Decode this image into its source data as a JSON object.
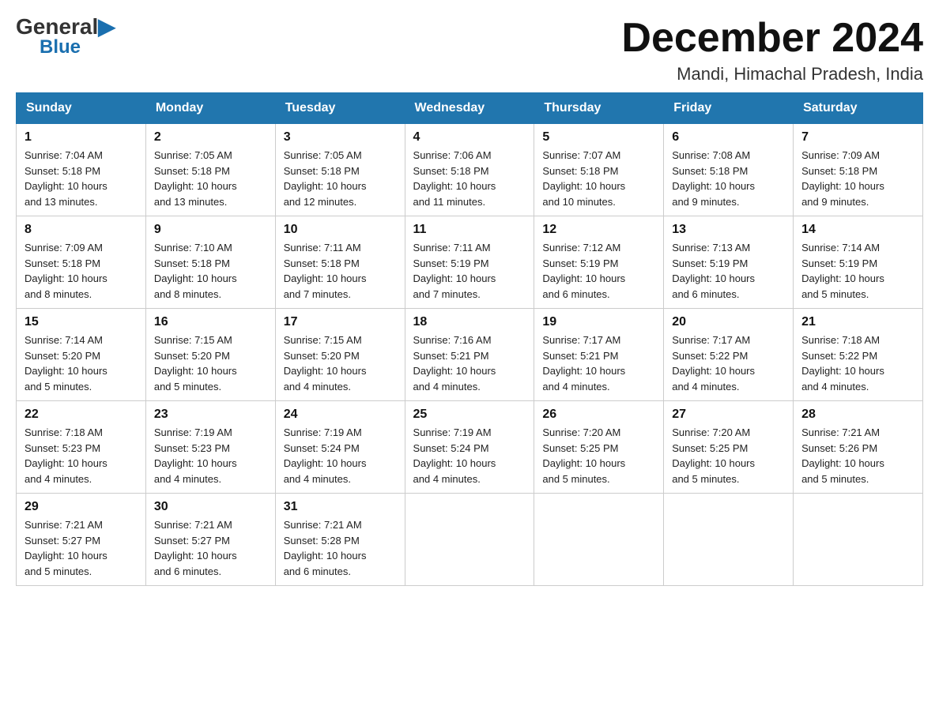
{
  "logo": {
    "general": "General",
    "blue": "Blue",
    "triangle": "▶"
  },
  "header": {
    "title": "December 2024",
    "subtitle": "Mandi, Himachal Pradesh, India"
  },
  "weekdays": [
    "Sunday",
    "Monday",
    "Tuesday",
    "Wednesday",
    "Thursday",
    "Friday",
    "Saturday"
  ],
  "weeks": [
    [
      {
        "day": "1",
        "sunrise": "7:04 AM",
        "sunset": "5:18 PM",
        "daylight": "10 hours and 13 minutes."
      },
      {
        "day": "2",
        "sunrise": "7:05 AM",
        "sunset": "5:18 PM",
        "daylight": "10 hours and 13 minutes."
      },
      {
        "day": "3",
        "sunrise": "7:05 AM",
        "sunset": "5:18 PM",
        "daylight": "10 hours and 12 minutes."
      },
      {
        "day": "4",
        "sunrise": "7:06 AM",
        "sunset": "5:18 PM",
        "daylight": "10 hours and 11 minutes."
      },
      {
        "day": "5",
        "sunrise": "7:07 AM",
        "sunset": "5:18 PM",
        "daylight": "10 hours and 10 minutes."
      },
      {
        "day": "6",
        "sunrise": "7:08 AM",
        "sunset": "5:18 PM",
        "daylight": "10 hours and 9 minutes."
      },
      {
        "day": "7",
        "sunrise": "7:09 AM",
        "sunset": "5:18 PM",
        "daylight": "10 hours and 9 minutes."
      }
    ],
    [
      {
        "day": "8",
        "sunrise": "7:09 AM",
        "sunset": "5:18 PM",
        "daylight": "10 hours and 8 minutes."
      },
      {
        "day": "9",
        "sunrise": "7:10 AM",
        "sunset": "5:18 PM",
        "daylight": "10 hours and 8 minutes."
      },
      {
        "day": "10",
        "sunrise": "7:11 AM",
        "sunset": "5:18 PM",
        "daylight": "10 hours and 7 minutes."
      },
      {
        "day": "11",
        "sunrise": "7:11 AM",
        "sunset": "5:19 PM",
        "daylight": "10 hours and 7 minutes."
      },
      {
        "day": "12",
        "sunrise": "7:12 AM",
        "sunset": "5:19 PM",
        "daylight": "10 hours and 6 minutes."
      },
      {
        "day": "13",
        "sunrise": "7:13 AM",
        "sunset": "5:19 PM",
        "daylight": "10 hours and 6 minutes."
      },
      {
        "day": "14",
        "sunrise": "7:14 AM",
        "sunset": "5:19 PM",
        "daylight": "10 hours and 5 minutes."
      }
    ],
    [
      {
        "day": "15",
        "sunrise": "7:14 AM",
        "sunset": "5:20 PM",
        "daylight": "10 hours and 5 minutes."
      },
      {
        "day": "16",
        "sunrise": "7:15 AM",
        "sunset": "5:20 PM",
        "daylight": "10 hours and 5 minutes."
      },
      {
        "day": "17",
        "sunrise": "7:15 AM",
        "sunset": "5:20 PM",
        "daylight": "10 hours and 4 minutes."
      },
      {
        "day": "18",
        "sunrise": "7:16 AM",
        "sunset": "5:21 PM",
        "daylight": "10 hours and 4 minutes."
      },
      {
        "day": "19",
        "sunrise": "7:17 AM",
        "sunset": "5:21 PM",
        "daylight": "10 hours and 4 minutes."
      },
      {
        "day": "20",
        "sunrise": "7:17 AM",
        "sunset": "5:22 PM",
        "daylight": "10 hours and 4 minutes."
      },
      {
        "day": "21",
        "sunrise": "7:18 AM",
        "sunset": "5:22 PM",
        "daylight": "10 hours and 4 minutes."
      }
    ],
    [
      {
        "day": "22",
        "sunrise": "7:18 AM",
        "sunset": "5:23 PM",
        "daylight": "10 hours and 4 minutes."
      },
      {
        "day": "23",
        "sunrise": "7:19 AM",
        "sunset": "5:23 PM",
        "daylight": "10 hours and 4 minutes."
      },
      {
        "day": "24",
        "sunrise": "7:19 AM",
        "sunset": "5:24 PM",
        "daylight": "10 hours and 4 minutes."
      },
      {
        "day": "25",
        "sunrise": "7:19 AM",
        "sunset": "5:24 PM",
        "daylight": "10 hours and 4 minutes."
      },
      {
        "day": "26",
        "sunrise": "7:20 AM",
        "sunset": "5:25 PM",
        "daylight": "10 hours and 5 minutes."
      },
      {
        "day": "27",
        "sunrise": "7:20 AM",
        "sunset": "5:25 PM",
        "daylight": "10 hours and 5 minutes."
      },
      {
        "day": "28",
        "sunrise": "7:21 AM",
        "sunset": "5:26 PM",
        "daylight": "10 hours and 5 minutes."
      }
    ],
    [
      {
        "day": "29",
        "sunrise": "7:21 AM",
        "sunset": "5:27 PM",
        "daylight": "10 hours and 5 minutes."
      },
      {
        "day": "30",
        "sunrise": "7:21 AM",
        "sunset": "5:27 PM",
        "daylight": "10 hours and 6 minutes."
      },
      {
        "day": "31",
        "sunrise": "7:21 AM",
        "sunset": "5:28 PM",
        "daylight": "10 hours and 6 minutes."
      },
      null,
      null,
      null,
      null
    ]
  ]
}
